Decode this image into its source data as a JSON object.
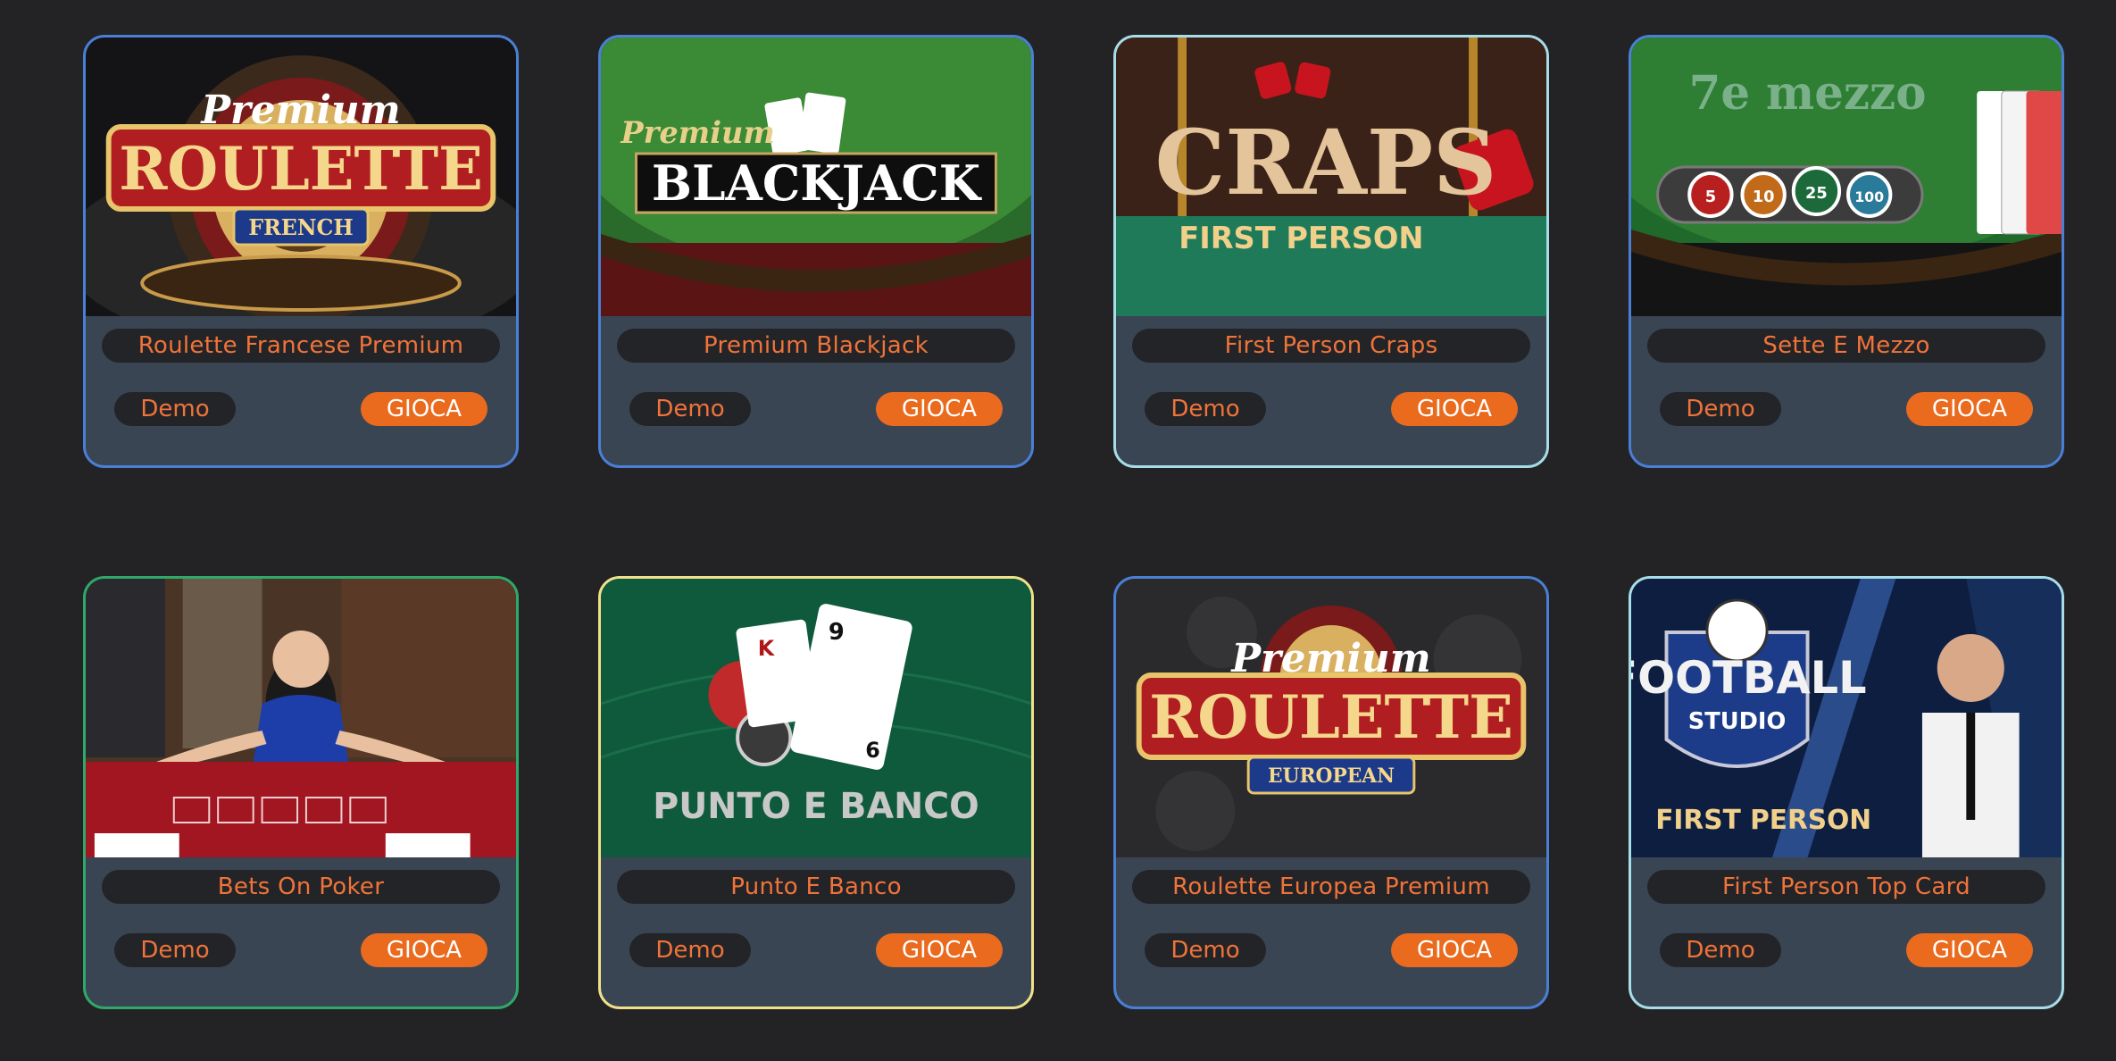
{
  "games": [
    {
      "title": "Roulette Francese Premium",
      "demo": "Demo",
      "play": "GIOCA",
      "border": "#4a7fd6",
      "art": {
        "top": "Premium",
        "main": "ROULETTE",
        "sub": "FRENCH"
      }
    },
    {
      "title": "Premium Blackjack",
      "demo": "Demo",
      "play": "GIOCA",
      "border": "#4a7fd6",
      "art": {
        "top": "Premium",
        "main": "BLACKJACK"
      }
    },
    {
      "title": "First Person Craps",
      "demo": "Demo",
      "play": "GIOCA",
      "border": "#a6dde8",
      "art": {
        "main": "CRAPS",
        "sub": "FIRST PERSON"
      }
    },
    {
      "title": "Sette E Mezzo",
      "demo": "Demo",
      "play": "GIOCA",
      "border": "#4a7fd6",
      "art": {
        "main": "7e mezzo",
        "chip1": "5",
        "chip2": "10",
        "chip3": "25",
        "chip4": "100"
      }
    },
    {
      "title": "Bets On Poker",
      "demo": "Demo",
      "play": "GIOCA",
      "border": "#2fa86a",
      "art": {}
    },
    {
      "title": "Punto E Banco",
      "demo": "Demo",
      "play": "GIOCA",
      "border": "#f1e08a",
      "art": {
        "main": "PUNTO E BANCO",
        "card1": "K",
        "card2": "9",
        "card2b": "6"
      }
    },
    {
      "title": "Roulette Europea Premium",
      "demo": "Demo",
      "play": "GIOCA",
      "border": "#4a7fd6",
      "art": {
        "top": "Premium",
        "main": "ROULETTE",
        "sub": "EUROPEAN"
      }
    },
    {
      "title": "First Person Top Card",
      "demo": "Demo",
      "play": "GIOCA",
      "border": "#a6dde8",
      "art": {
        "main": "FOOTBALL",
        "mid": "STUDIO",
        "sub": "FIRST PERSON"
      }
    }
  ],
  "colors": {
    "background": "#232325",
    "panel": "#3a4554",
    "accent": "#ea6a1e",
    "text_accent": "#f0733a"
  }
}
